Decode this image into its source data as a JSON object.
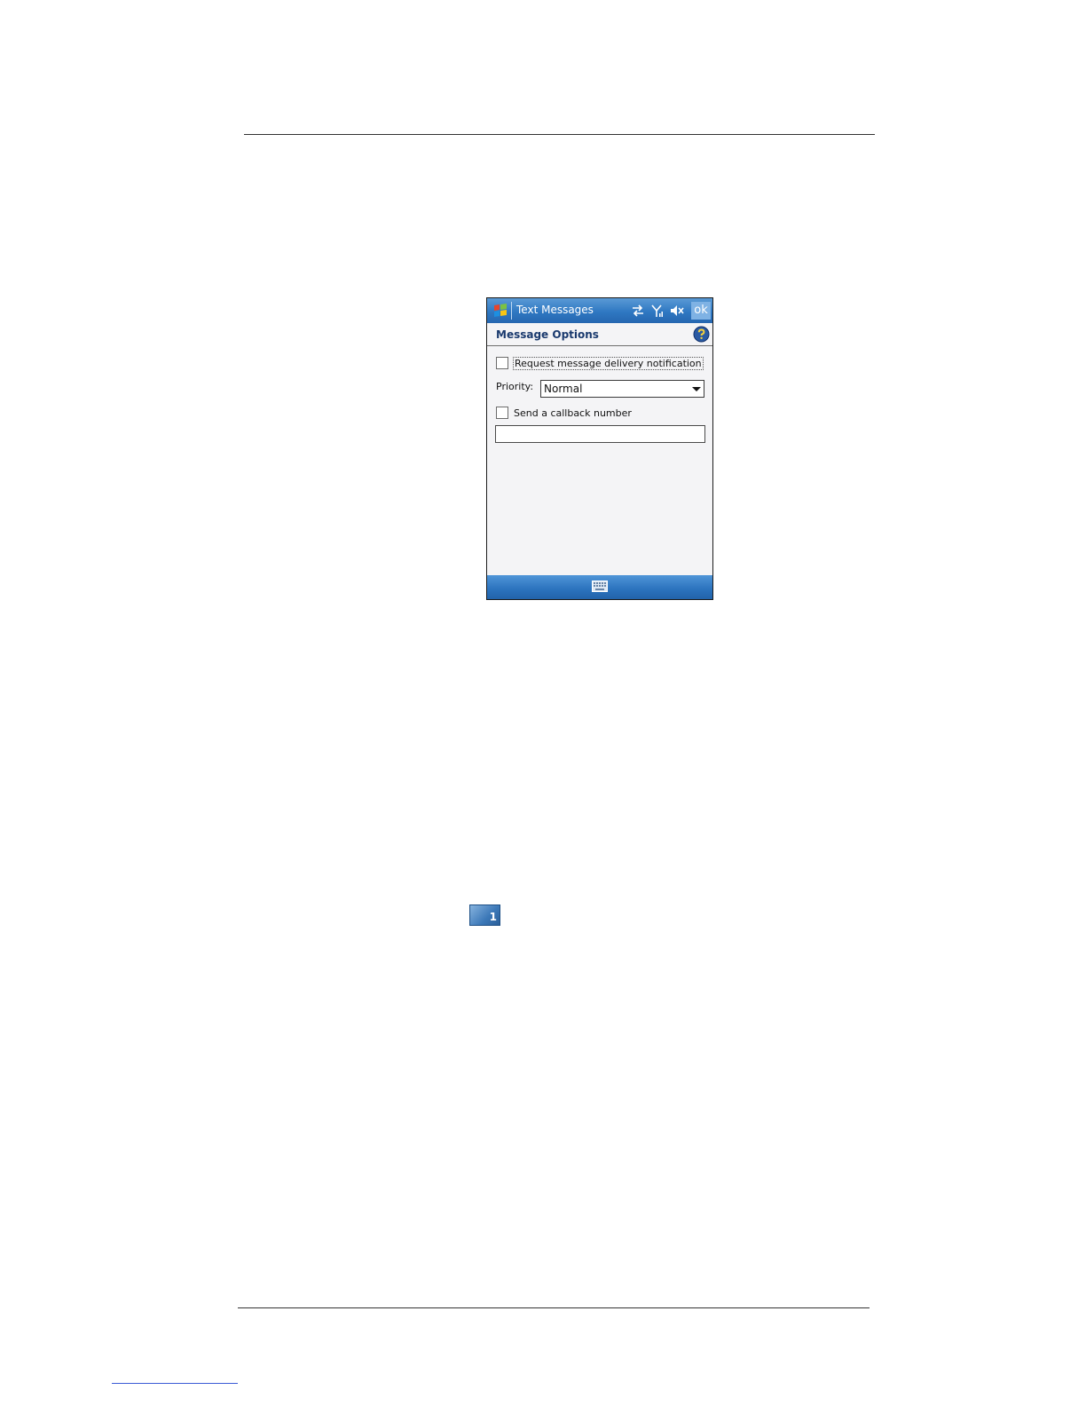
{
  "app": {
    "title": "Text Messages",
    "ok_label": "ok"
  },
  "header": {
    "title": "Message Options"
  },
  "form": {
    "delivery_notification": {
      "label": "Request message delivery notification",
      "checked": false
    },
    "priority": {
      "label": "Priority:",
      "value": "Normal"
    },
    "callback": {
      "label": "Send a callback number",
      "checked": false,
      "value": ""
    }
  },
  "badge": {
    "number": "1"
  },
  "icons": {
    "start": "windows-flag-icon",
    "connectivity": "connectivity-arrows-icon",
    "signal": "signal-icon",
    "volume": "speaker-muted-icon",
    "help": "help-icon",
    "keyboard": "keyboard-icon"
  },
  "colors": {
    "titlebar": "#2f78c2",
    "header_text": "#1a3a6e",
    "screen_bg": "#f4f4f6"
  }
}
